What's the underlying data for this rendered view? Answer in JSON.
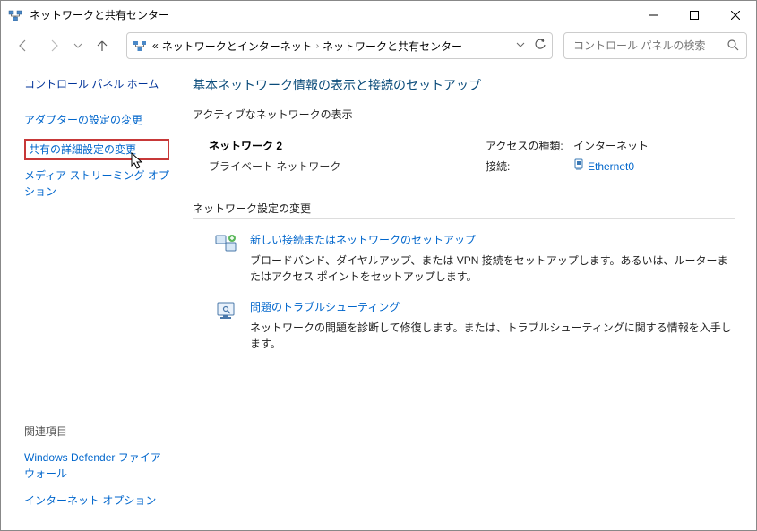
{
  "titlebar": {
    "title": "ネットワークと共有センター"
  },
  "nav": {
    "breadcrumb_prefix": "«",
    "breadcrumb_1": "ネットワークとインターネット",
    "breadcrumb_2": "ネットワークと共有センター",
    "search_placeholder": "コントロール パネルの検索"
  },
  "sidebar": {
    "home": "コントロール パネル ホーム",
    "links": [
      "アダプターの設定の変更",
      "共有の詳細設定の変更",
      "メディア ストリーミング オプション"
    ],
    "related_heading": "関連項目",
    "related": [
      "Windows Defender ファイアウォール",
      "インターネット オプション"
    ]
  },
  "main": {
    "heading": "基本ネットワーク情報の表示と接続のセットアップ",
    "active_label": "アクティブなネットワークの表示",
    "network": {
      "name": "ネットワーク 2",
      "type": "プライベート ネットワーク",
      "access_type_label": "アクセスの種類:",
      "access_type_value": "インターネット",
      "connection_label": "接続:",
      "connection_value": "Ethernet0"
    },
    "settings_header": "ネットワーク設定の変更",
    "setting1": {
      "title": "新しい接続またはネットワークのセットアップ",
      "desc": "ブロードバンド、ダイヤルアップ、または VPN 接続をセットアップします。あるいは、ルーターまたはアクセス ポイントをセットアップします。"
    },
    "setting2": {
      "title": "問題のトラブルシューティング",
      "desc": "ネットワークの問題を診断して修復します。または、トラブルシューティングに関する情報を入手します。"
    }
  }
}
